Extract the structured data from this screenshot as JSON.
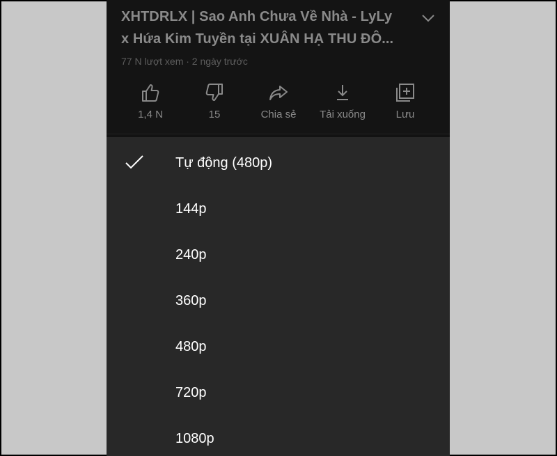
{
  "video": {
    "title_line1": "XHTDRLX | Sao Anh Chưa Về Nhà - LyLy",
    "title_line2": "x Hứa Kim Tuyền tại XUÂN HẠ THU ĐÔ...",
    "meta": "77 N lượt xem · 2 ngày trước"
  },
  "actions": [
    {
      "icon": "thumbs-up-icon",
      "label": "1,4 N"
    },
    {
      "icon": "thumbs-down-icon",
      "label": "15"
    },
    {
      "icon": "share-icon",
      "label": "Chia sẻ"
    },
    {
      "icon": "download-icon",
      "label": "Tải xuống"
    },
    {
      "icon": "save-to-playlist-icon",
      "label": "Lưu"
    }
  ],
  "quality_menu": {
    "selected_index": 0,
    "options": [
      {
        "label": "Tự động (480p)"
      },
      {
        "label": "144p"
      },
      {
        "label": "240p"
      },
      {
        "label": "360p"
      },
      {
        "label": "480p"
      },
      {
        "label": "720p"
      },
      {
        "label": "1080p"
      }
    ]
  },
  "colors": {
    "background": "#c8c8c8",
    "panel": "#141414",
    "sheet": "#282828",
    "text_primary": "#ffffff",
    "text_dim": "#8a8a8a"
  }
}
